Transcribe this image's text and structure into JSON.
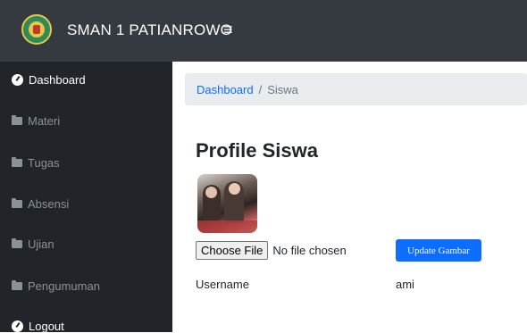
{
  "header": {
    "brand": "SMAN 1 PATIANROWO",
    "menu_icon": "≡"
  },
  "sidebar": {
    "items": [
      {
        "label": "Dashboard",
        "icon": "dashboard-icon",
        "active": true
      },
      {
        "label": "Materi",
        "icon": "folder-icon",
        "active": false
      },
      {
        "label": "Tugas",
        "icon": "folder-icon",
        "active": false
      },
      {
        "label": "Absensi",
        "icon": "folder-icon",
        "active": false
      },
      {
        "label": "Ujian",
        "icon": "folder-icon",
        "active": false
      },
      {
        "label": "Pengumuman",
        "icon": "folder-icon",
        "active": false
      },
      {
        "label": "Logout",
        "icon": "dashboard-icon",
        "active": false
      }
    ]
  },
  "breadcrumb": {
    "home": "Dashboard",
    "separator": "/",
    "current": "Siswa"
  },
  "main": {
    "title": "Profile Siswa",
    "file_button": "Choose File",
    "file_status": "No file chosen",
    "update_button": "Update Gambar",
    "username_label": "Username",
    "username_value": "ami"
  },
  "colors": {
    "topbar": "#343a40",
    "sidebar": "#212529",
    "accent": "#0d6efd",
    "breadcrumb_bg": "#e9ecef"
  }
}
